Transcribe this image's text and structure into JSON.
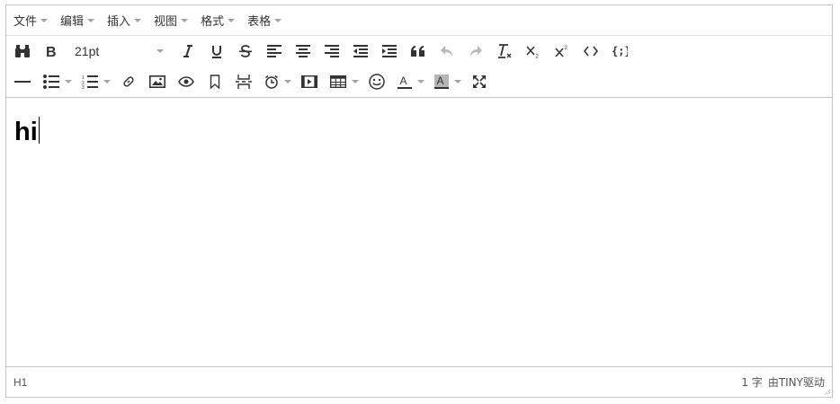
{
  "menubar": {
    "items": [
      "文件",
      "编辑",
      "插入",
      "视图",
      "格式",
      "表格"
    ]
  },
  "toolbar": {
    "font_size": "21pt",
    "row1_icons": [
      "find-icon",
      "bold-icon",
      "italic-icon",
      "underline-icon",
      "strikethrough-icon",
      "align-left-icon",
      "align-center-icon",
      "align-right-icon",
      "outdent-icon",
      "indent-icon",
      "blockquote-icon",
      "undo-icon",
      "redo-icon",
      "remove-format-icon",
      "subscript-icon",
      "superscript-icon",
      "code-icon",
      "code-sample-icon"
    ],
    "row2_icons": [
      "horizontal-rule-icon",
      "bullet-list-icon",
      "numbered-list-icon",
      "link-icon",
      "image-icon",
      "preview-icon",
      "bookmark-icon",
      "page-break-icon",
      "datetime-icon",
      "media-icon",
      "table-icon",
      "emoticon-icon",
      "text-color-icon",
      "background-color-icon",
      "fullscreen-icon"
    ]
  },
  "editor": {
    "heading_text": "hi"
  },
  "statusbar": {
    "path": "H1",
    "word_count": "1 字",
    "branding": "由TINY驱动"
  },
  "colors": {
    "border": "#c5c5c5",
    "icon": "#333333",
    "caret": "#a3a3a3"
  }
}
